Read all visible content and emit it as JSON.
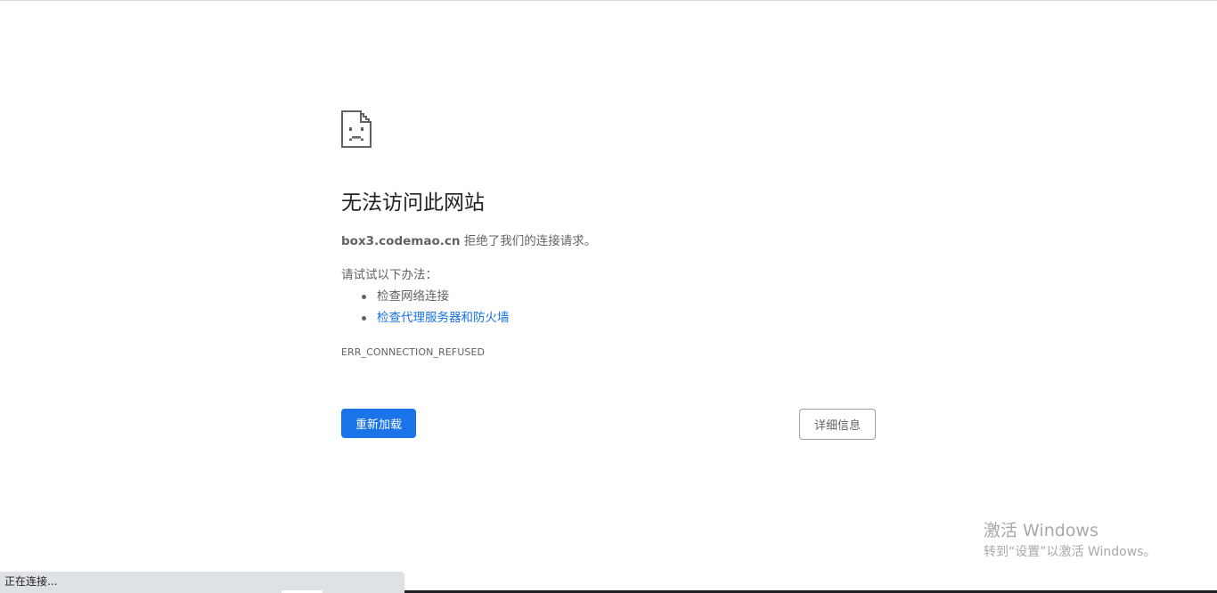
{
  "error_page": {
    "icon": "sad-page-icon",
    "heading": "无法访问此网站",
    "host": "box3.codemao.cn",
    "summary_rest": " 拒绝了我们的连接请求。",
    "try_label": "请试试以下办法：",
    "suggestions": [
      {
        "label": "检查网络连接",
        "is_link": false
      },
      {
        "label": "检查代理服务器和防火墙",
        "is_link": true
      }
    ],
    "error_code": "ERR_CONNECTION_REFUSED",
    "reload_label": "重新加载",
    "details_label": "详细信息"
  },
  "watermark": {
    "title": "激活 Windows",
    "subtitle": "转到“设置”以激活 Windows。"
  },
  "status_bar": {
    "text": "正在连接..."
  },
  "colors": {
    "accent": "#1a73e8",
    "text_secondary": "#5f6368",
    "heading": "#202124",
    "status_bg": "#dee1e6"
  }
}
